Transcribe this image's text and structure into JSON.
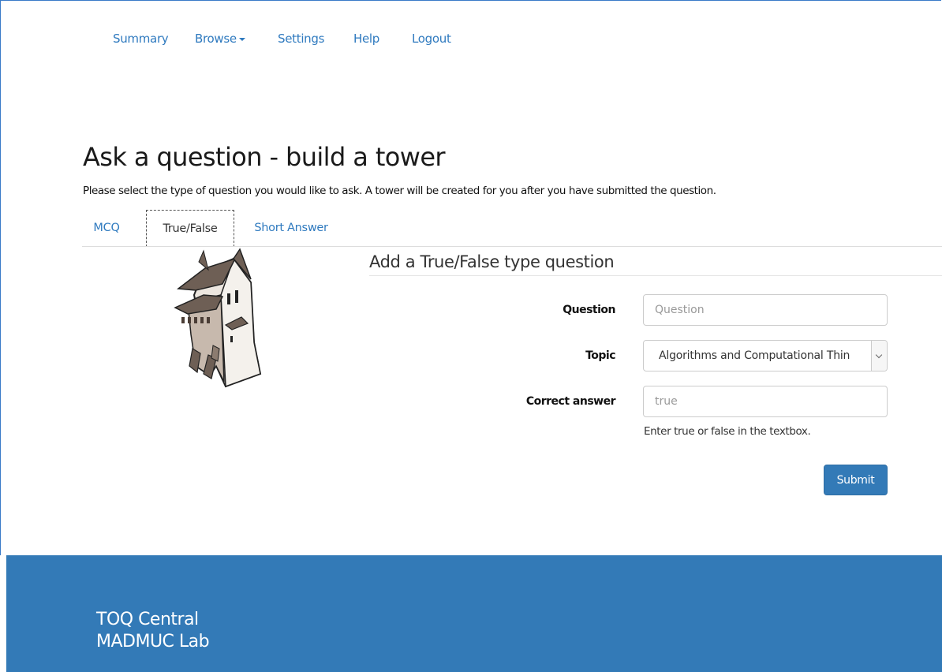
{
  "nav": {
    "items": [
      {
        "label": "Summary"
      },
      {
        "label": "Browse",
        "has_dropdown": true
      },
      {
        "label": "Settings"
      },
      {
        "label": "Help"
      },
      {
        "label": "Logout"
      }
    ]
  },
  "page": {
    "title": "Ask a question - build a tower",
    "description": "Please select the type of question you would like to ask. A tower will be created for you after you have submitted the question."
  },
  "tabs": [
    {
      "label": "MCQ",
      "active": false
    },
    {
      "label": "True/False",
      "active": true
    },
    {
      "label": "Short Answer",
      "active": false
    }
  ],
  "form": {
    "title": "Add a True/False type question",
    "question": {
      "label": "Question",
      "value": "",
      "placeholder": "Question"
    },
    "topic": {
      "label": "Topic",
      "selected": "Algorithms and Computational Thin"
    },
    "correct_answer": {
      "label": "Correct answer",
      "value": "",
      "placeholder": "true",
      "help": "Enter true or false in the textbox."
    },
    "submit_label": "Submit"
  },
  "footer": {
    "line1": "TOQ Central",
    "line2": "MADMUC Lab"
  },
  "colors": {
    "link": "#2f7abf",
    "primary": "#337ab7"
  }
}
